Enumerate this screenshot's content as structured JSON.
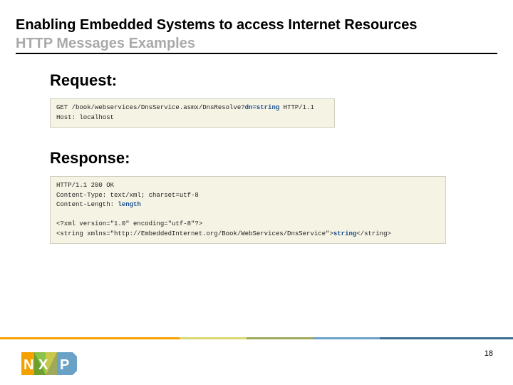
{
  "header": {
    "title": "Enabling Embedded Systems to access Internet Resources",
    "subtitle": "HTTP Messages Examples"
  },
  "request": {
    "label": "Request:",
    "line1_pre": "GET /book/webservices/DnsService.asmx/DnsResolve?",
    "line1_hl": "dn=string",
    "line1_post": " HTTP/1.1",
    "line2": "Host: localhost"
  },
  "response": {
    "label": "Response:",
    "line1": "HTTP/1.1 200 OK",
    "line2": "Content-Type: text/xml; charset=utf-8",
    "line3_pre": "Content-Length: ",
    "line3_hl": "length",
    "line4": "",
    "line5": "<?xml version=\"1.0\" encoding=\"utf-8\"?>",
    "line6_pre": "<string xmlns=\"http://EmbeddedInternet.org/Book/WebServices/DnsService\">",
    "line6_hl": "string",
    "line6_post": "</string>"
  },
  "footer": {
    "page": "18",
    "logo_colors": {
      "orange": "#f5a100",
      "blue": "#6aa2c7",
      "green": "#9eaa5b",
      "yellow": "#d8d86e"
    }
  }
}
